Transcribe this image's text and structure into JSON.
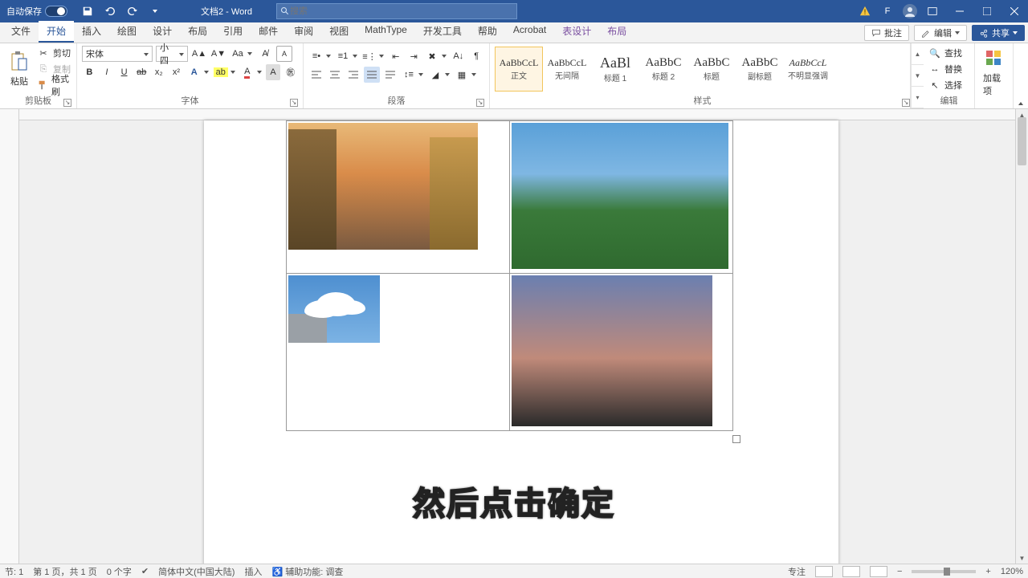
{
  "titlebar": {
    "autosave_label": "自动保存",
    "doc_title": "文档2 - Word",
    "search_placeholder": "搜索",
    "user_initial": "F"
  },
  "tabs": {
    "items": [
      "文件",
      "开始",
      "插入",
      "绘图",
      "设计",
      "布局",
      "引用",
      "邮件",
      "审阅",
      "视图",
      "MathType",
      "开发工具",
      "帮助",
      "Acrobat",
      "表设计",
      "布局"
    ],
    "active_index": 1,
    "context_start_index": 14,
    "markup_btn": "批注",
    "edit_btn": "编辑",
    "share_btn": "共享"
  },
  "ribbon": {
    "clipboard": {
      "paste": "粘贴",
      "cut": "剪切",
      "copy": "复制",
      "painter": "格式刷",
      "label": "剪贴板"
    },
    "font": {
      "name": "宋体",
      "size": "小四",
      "label": "字体"
    },
    "paragraph": {
      "label": "段落"
    },
    "styles": {
      "label": "样式",
      "items": [
        {
          "preview": "AaBbCcL",
          "name": "正文",
          "sel": true,
          "size": "12px"
        },
        {
          "preview": "AaBbCcL",
          "name": "无间隔",
          "sel": false,
          "size": "12px"
        },
        {
          "preview": "AaBl",
          "name": "标题 1",
          "sel": false,
          "size": "18px"
        },
        {
          "preview": "AaBbC",
          "name": "标题 2",
          "sel": false,
          "size": "15px"
        },
        {
          "preview": "AaBbC",
          "name": "标题",
          "sel": false,
          "size": "15px"
        },
        {
          "preview": "AaBbC",
          "name": "副标题",
          "sel": false,
          "size": "15px"
        },
        {
          "preview": "AaBbCcL",
          "name": "不明显强调",
          "sel": false,
          "size": "12px",
          "italic": true
        }
      ]
    },
    "editing": {
      "find": "查找",
      "replace": "替换",
      "select": "选择",
      "label": "编辑"
    },
    "addins": {
      "label": "加载项"
    }
  },
  "caption_text": "然后点击确定",
  "status": {
    "section": "节: 1",
    "page": "第 1 页，共 1 页",
    "words": "0 个字",
    "lang": "简体中文(中国大陆)",
    "insert_mode": "插入",
    "a11y": "辅助功能: 调查",
    "focus": "专注",
    "zoom": "120%"
  },
  "colors": {
    "accent": "#2b579a"
  }
}
